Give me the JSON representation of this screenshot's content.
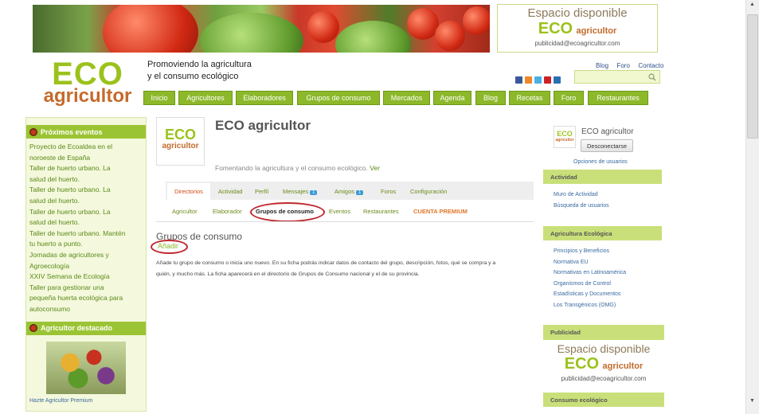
{
  "header": {
    "ad_top": {
      "title": "Espacio disponible",
      "eco": "ECO",
      "agri": "agricultor",
      "email": "publicidad@ecoagricultor.com"
    },
    "logo": {
      "eco": "ECO",
      "agri": "agricultor"
    },
    "tagline_line1": "Promoviendo la agricultura",
    "tagline_line2": "y el consumo ecológico",
    "top_links": [
      "Blog",
      "Foro",
      "Contacto"
    ],
    "social_icons": [
      "facebook-icon",
      "rss-icon",
      "twitter-icon",
      "pinterest-icon",
      "linkedin-icon"
    ],
    "search": {
      "placeholder": ""
    }
  },
  "nav": [
    "Inicio",
    "Agricultores",
    "Elaboradores",
    "Grupos de consumo",
    "Mercados",
    "Agenda",
    "Blog",
    "Recetas",
    "Foro",
    "Restaurantes"
  ],
  "left_sidebar": {
    "events_title": "Próximos eventos",
    "events": [
      "Proyecto de Ecoaldea en el",
      "noroeste de España",
      "Taller de huerto urbano. La",
      "salud del huerto.",
      "Taller de huerto urbano. La",
      "salud del huerto.",
      "Taller de huerto urbano. La",
      "salud del huerto.",
      "Taller de huerto urbano. Mantén",
      "tu huerto a punto.",
      "Jornadas de agricultores y",
      "Agroecología",
      "XXIV Semana de Ecología",
      "Taller para gestionar una",
      "pequeña huerta ecológica para",
      "autoconsumo"
    ],
    "featured_title": "Agricultor destacado",
    "featured_caption": "Hazte Agricultor Premium"
  },
  "profile": {
    "logo_eco": "ECO",
    "logo_agri": "agricultor",
    "name": "ECO agricultor",
    "subtitle": "Fomentando la agricultura y el consumo ecológico.",
    "subtitle_link": "Ver"
  },
  "tabs": {
    "active": "Directorios",
    "items": [
      "Actividad",
      "Perfil",
      "Mensajes",
      "Amigos",
      "Foros",
      "Configuración"
    ],
    "mensajes_count": "1",
    "amigos_count": "1"
  },
  "subtabs": {
    "items": [
      "Agricultor",
      "Elaborador",
      "Grupos de consumo",
      "Eventos",
      "Restaurantes"
    ],
    "premium": "CUENTA PREMIUM"
  },
  "content": {
    "section_title": "Grupos de consumo",
    "add_link": "Añadir",
    "description_line1": "Añade tu grupo de consumo o inicia uno nuevo. En su ficha podrás indicar datos de contacto del grupo, descripción, fotos, qué se compra y a",
    "description_line2": "quién, y mucho más. La ficha aparecerá en el directorio de Grupos de Consumo nacional y el de su provincia."
  },
  "right_sidebar": {
    "user_name": "ECO agricultor",
    "user_logo_eco": "ECO",
    "user_logo_agri": "agricultor",
    "disconnect": "Desconectarse",
    "user_options": "Opciones de usuarios",
    "actividad_title": "Actividad",
    "actividad_links": [
      "Muro de Actividad",
      "Búsqueda de usuarios"
    ],
    "agri_title": "Agricultura Ecológica",
    "agri_links": [
      "Principios y Beneficios",
      "Normativa EU",
      "Normativas en Latinoamérica",
      "Organismos de Control",
      "Estadísticas y Documentos",
      "Los Transgénicos (OMG)"
    ],
    "publicidad_title": "Publicidad",
    "ad": {
      "title": "Espacio disponible",
      "eco": "ECO",
      "agri": "agricultor",
      "email": "publicidad@ecoagricultor.com"
    },
    "consumo_title": "Consumo ecológico"
  },
  "colors": {
    "nav_green": "#8cb82a",
    "sidebar_head_green": "#9bc434",
    "right_head_green": "#c9e07a",
    "highlight_red": "#c0282e"
  }
}
